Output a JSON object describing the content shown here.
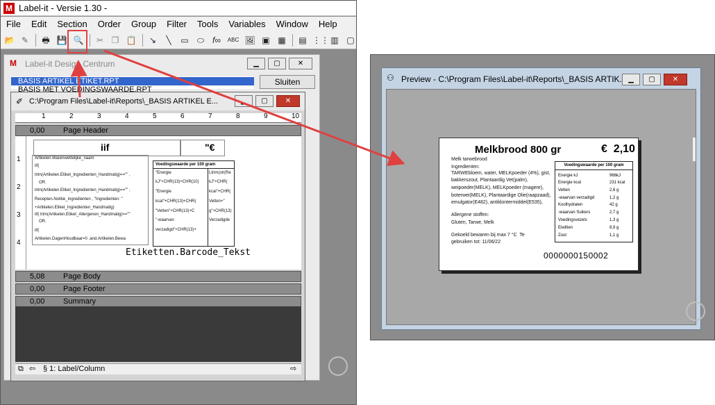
{
  "app": {
    "title": "Label-it - Versie 1.30 -",
    "logo": "M",
    "menu": [
      "File",
      "Edit",
      "Section",
      "Order",
      "Group",
      "Filter",
      "Tools",
      "Variables",
      "Window",
      "Help"
    ]
  },
  "toolbar_icons": [
    "open-icon",
    "edit-icon",
    "print-icon",
    "save-icon",
    "print-preview-icon",
    "cut-icon",
    "copy-icon",
    "paste-icon",
    "pointer-icon",
    "line-icon",
    "rectangle-icon",
    "ellipse-icon",
    "function-icon",
    "text-icon",
    "picture-icon",
    "box-icon",
    "gradient-icon"
  ],
  "toolbar_glyphs": {
    "function": "f∞",
    "text": "ABC"
  },
  "design_centrum": {
    "title": "Label-it Design Centrum",
    "items": [
      "BASIS ARTIKEL ETIKET.RPT",
      "BASIS MET VOEDINGSWAARDE.RPT"
    ],
    "close_button": "Sluiten"
  },
  "designer": {
    "title": "C:\\Program Files\\Label-it\\Reports\\_BASIS ARTIKEL E...",
    "ruler_top": [
      "1",
      "2",
      "3",
      "4",
      "5",
      "6",
      "7",
      "8",
      "9",
      "10"
    ],
    "ruler_left": [
      "1",
      "2",
      "3",
      "4"
    ],
    "bands": [
      {
        "value": "0,00",
        "name": "Page Header"
      },
      {
        "value": "5,08",
        "name": "Page Body"
      },
      {
        "value": "0,00",
        "name": "Page Footer"
      },
      {
        "value": "0,00",
        "name": "Summary"
      }
    ],
    "header_fields": {
      "iif": "iif",
      "price": "\"€"
    },
    "expressions": [
      "Artikelen.Warenwettelijke_naam",
      "iif(",
      "trim(Artikelen.Etiket_Ingredienten_Handmatig)==\"\" ,",
      "OR.",
      "trim(Artikelen.Etiket_Ingredienten_Handmatig)==\"\" ,",
      "Recepten.Notitie_ingredienten , \"Ingredienten: \"",
      "+Artikelen.Etiket_Ingredienten_Handmatig)",
      "iif( trim(Artikelen.Etiket_Allergenen_Handmatig)==\"\"",
      "OR.",
      "iif(",
      "Artikelen.DagenHoudbaar=0 .and.Artikelen.Bewa"
    ],
    "nutrition_header": "Voedingswaarde per 100 gram",
    "nutrition_expr_left": [
      "\"Energie",
      "kJ\"+CHR(13)+CHR(10)",
      "\"Energie",
      "kcal\"+CHR(13)+CHR(",
      "\"Vetten\"+CHR(13)+C",
      "\"-waarvan",
      "verzadigd\"+CHR(13)+"
    ],
    "nutrition_expr_right": [
      "Ltrim(str(Re",
      "kJ\"+CHR(",
      "kcal\"+CHR(",
      "Vetten+\"",
      "g\"+CHR(13)",
      "Verzadigde"
    ],
    "barcode_field": "Etiketten.Barcode_Tekst",
    "status_tab": "§ 1: Label/Column"
  },
  "preview": {
    "title": "Preview - C:\\Program Files\\Label-it\\Reports\\_BASIS ARTIK...",
    "product_name": "Melkbrood 800 gr",
    "price": "€  2,10",
    "legal_name": "Melk tarwebrood",
    "ingredients_lines": [
      "Ingredienten:",
      "TARWEbloem, water, MELKpoeder (4%), gist,",
      "bakkerszout, Plantaardig Vet(palm),",
      "weipoeder(MELK), MELKpoeder (magere),",
      "boterwei(MELK), Plantaardige Olie(raapzaad),",
      "emulgator(E482), antiklontermiddel(E535),"
    ],
    "allergens_lines": [
      "Allergene stoffen:",
      "Gluten, Tarwe, Melk"
    ],
    "storage_lines": [
      "Gekoeld bewaren bij max 7 °C  Te",
      "gebruiken tot: 11/06/22"
    ],
    "barcode": "0000000150002",
    "nutrition_header": "Voedingswaarde per 100 gram",
    "nutrition": [
      {
        "name": "Energie kJ",
        "value": "966kJ"
      },
      {
        "name": "Energie kcal",
        "value": "231 kcal"
      },
      {
        "name": "Vetten",
        "value": "2,6 g"
      },
      {
        "name": "-waarvan verzadigd",
        "value": "1,2 g"
      },
      {
        "name": "Koolhydraten",
        "value": "42 g"
      },
      {
        "name": "-waarvan Suikers",
        "value": "2,7 g"
      },
      {
        "name": "Voedingsvezels",
        "value": "1,3 g"
      },
      {
        "name": "Eiwitten",
        "value": "8,9 g"
      },
      {
        "name": "Zout",
        "value": "1,1 g"
      }
    ]
  },
  "colors": {
    "highlight": "#e04040",
    "selection": "#3366cc",
    "close": "#c0392b"
  }
}
